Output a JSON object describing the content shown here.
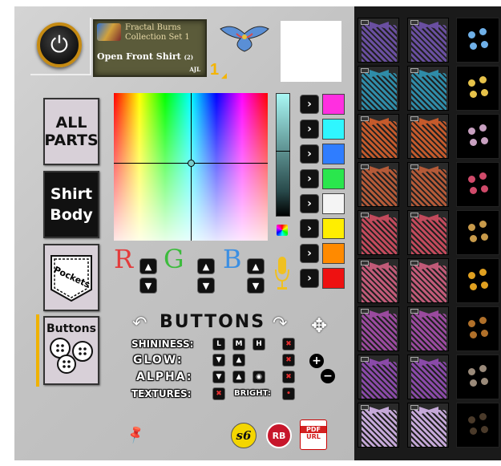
{
  "header": {
    "collection_line1": "Fractal Burns",
    "collection_line2": "Collection Set 1",
    "product_name": "Open Front Shirt",
    "product_sub": "(2)",
    "author": "AJL",
    "page_number": "1"
  },
  "parts": {
    "all_line1": "ALL",
    "all_line2": "PARTS",
    "body_line1": "Shirt",
    "body_line2": "Body",
    "pockets": "Pockets",
    "buttons": "Buttons",
    "selected": "Buttons"
  },
  "color_swatches": [
    "#ff2fe0",
    "#2ff6ff",
    "#2f7dff",
    "#2ae64d",
    "#f4f4f4",
    "#ffee00",
    "#ff8a00",
    "#ee1111"
  ],
  "rgb": {
    "r": "R",
    "g": "G",
    "b": "B",
    "r_color": "#e33b3b",
    "g_color": "#3dbb3d",
    "b_color": "#3b8fe3"
  },
  "controls": {
    "title": "BUTTONS",
    "shininess": "SHININESS:",
    "glow": "GLOW:",
    "alpha": "ALPHA:",
    "textures": "TEXTURES:",
    "bright": "BRIGHT:",
    "shine_l": "L",
    "shine_m": "M",
    "shine_h": "H"
  },
  "footer": {
    "s6": "s6",
    "rb": "RB",
    "pdf": "PDF",
    "url": "URL"
  },
  "shirt_tile_colors": [
    "#6a4fa0",
    "#2f8ca8",
    "#c45a2c",
    "#b45a38",
    "#c24a5c",
    "#c15a78",
    "#9a4a9e",
    "#8a4aa8",
    "#c5a8d8"
  ],
  "button_tile_colors": [
    "#6fb0e8",
    "#e6c24a",
    "#c8a0c0",
    "#d04a6a",
    "#c89a4a",
    "#e0a020",
    "#b0702a",
    "#9a8a7a",
    "#4a3a2a"
  ]
}
